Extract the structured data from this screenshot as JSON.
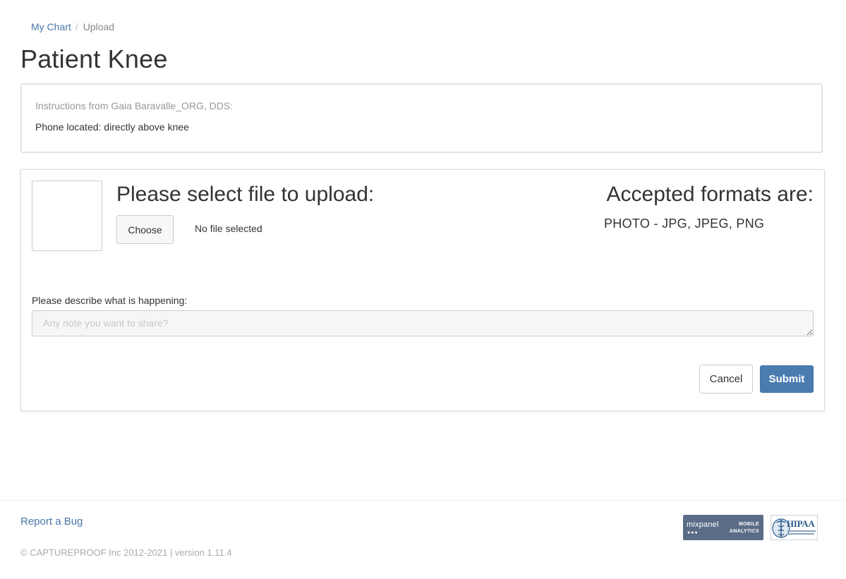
{
  "breadcrumb": {
    "items": [
      {
        "label": "My Chart",
        "link": true
      },
      {
        "label": "Upload",
        "link": false
      }
    ],
    "separator": "/"
  },
  "page": {
    "title": "Patient Knee"
  },
  "instructions": {
    "heading": "Instructions from Gaia Baravalle_ORG, DDS:",
    "text": "Phone located: directly above knee"
  },
  "upload": {
    "heading": "Please select file to upload:",
    "choose_label": "Choose",
    "file_status": "No file selected",
    "formats_heading": "Accepted formats are:",
    "formats_list": "PHOTO - JPG, JPEG, PNG",
    "describe_label": "Please describe what is happening:",
    "note_placeholder": "Any note you want to share?",
    "note_value": "",
    "cancel_label": "Cancel",
    "submit_label": "Submit"
  },
  "footer": {
    "report_bug": "Report a Bug",
    "copyright": "© CAPTUREPROOF Inc 2012-2021 | version 1.11.4",
    "mixpanel": {
      "name": "mixpanel",
      "tag_line1": "MOBILE",
      "tag_line2": "ANALYTICS"
    },
    "hipaa": {
      "text": "HIPAA"
    }
  },
  "colors": {
    "link": "#4a76a8",
    "primary_button": "#4a7cb0",
    "mixpanel_badge": "#5b6c87",
    "hipaa_text": "#2b5d8c"
  },
  "icons": {
    "hipaa_emblem": "caduceus-icon",
    "mixpanel_dots": "mixpanel-dots-icon"
  }
}
